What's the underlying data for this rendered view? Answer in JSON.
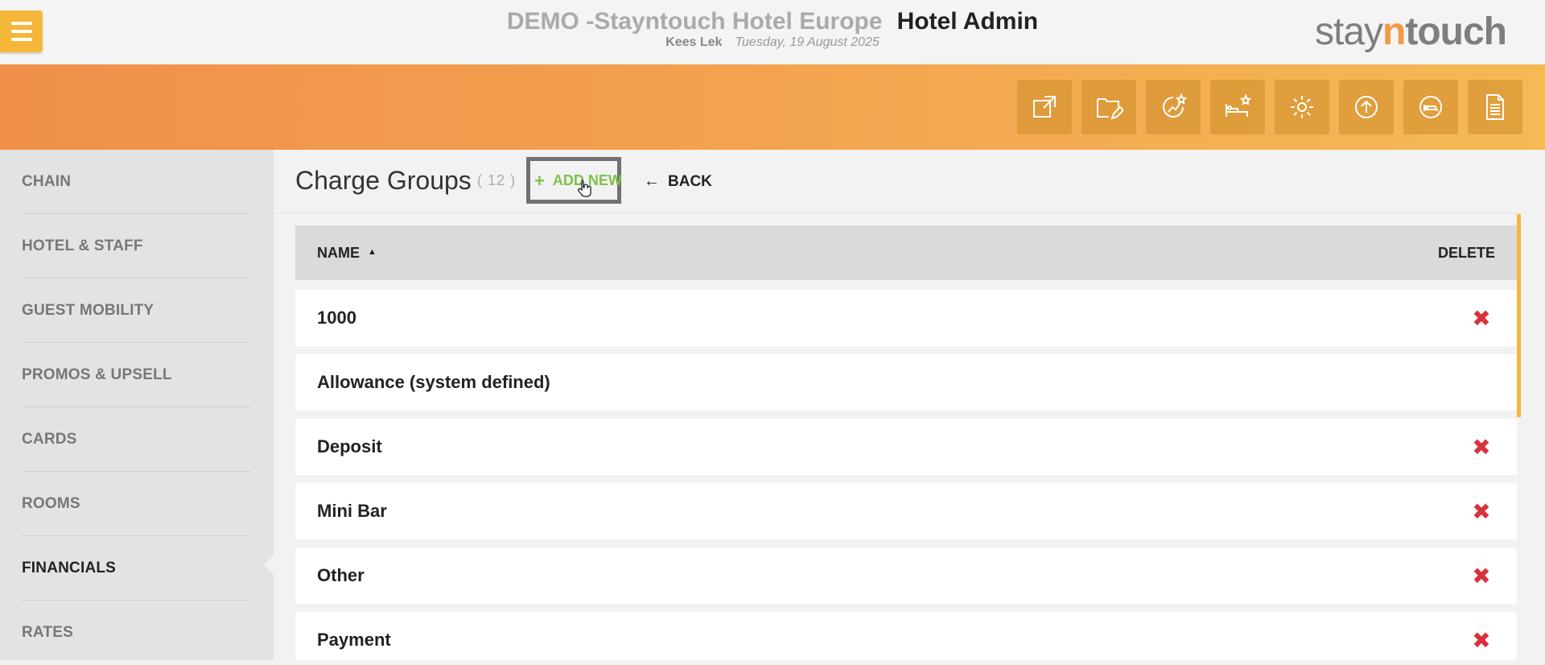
{
  "header": {
    "hotel_name": "DEMO -Stayntouch Hotel Europe",
    "app_name": "Hotel Admin",
    "user": "Kees Lek",
    "date": "Tuesday, 19 August 2025",
    "logo": {
      "part1": "stay",
      "part2": "n",
      "part3": "touch"
    }
  },
  "nav_icons": [
    "external-link-icon",
    "folder-edit-icon",
    "star-chart-icon",
    "bed-star-icon",
    "gear-icon",
    "upload-icon",
    "bed-icon",
    "document-icon"
  ],
  "sidebar": {
    "items": [
      {
        "label": "CHAIN"
      },
      {
        "label": "HOTEL & STAFF"
      },
      {
        "label": "GUEST MOBILITY"
      },
      {
        "label": "PROMOS & UPSELL"
      },
      {
        "label": "CARDS"
      },
      {
        "label": "ROOMS"
      },
      {
        "label": "FINANCIALS",
        "active": true
      },
      {
        "label": "RATES"
      }
    ]
  },
  "main": {
    "title": "Charge Groups",
    "count": "( 12 )",
    "add_new_label": "ADD NEW",
    "back_label": "BACK",
    "table": {
      "columns": [
        "NAME",
        "DELETE"
      ],
      "sort_indicator": "▲",
      "rows": [
        {
          "name": "1000",
          "deletable": true
        },
        {
          "name": "Allowance (system defined)",
          "deletable": false
        },
        {
          "name": "Deposit",
          "deletable": true
        },
        {
          "name": "Mini Bar",
          "deletable": true
        },
        {
          "name": "Other",
          "deletable": true
        },
        {
          "name": "Payment",
          "deletable": true
        }
      ]
    }
  },
  "colors": {
    "accent_orange": "#f39a45",
    "add_green": "#7cc24a",
    "delete_red": "#d8323c",
    "menu_yellow": "#f5b73a"
  }
}
